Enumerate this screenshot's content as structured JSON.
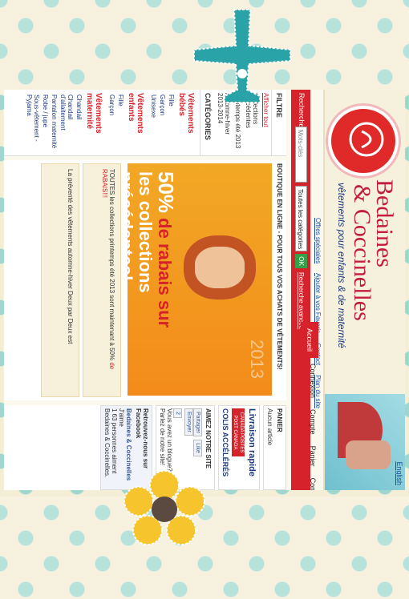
{
  "header": {
    "brand_line1": "Bedaines",
    "brand_line2": "& Coccinelles",
    "tagline": "vêtements pour enfants & de maternité",
    "english_link": "English"
  },
  "toplinks": [
    "Offres spéciales",
    "Ajouter à vos Favoris",
    "Contact",
    "Plan du site"
  ],
  "search": {
    "label": "Recherche :",
    "placeholder": "Mots-clés",
    "category": "Toutes les catégories",
    "ok": "OK",
    "advanced": "Recherche avancée"
  },
  "menu": [
    "Accueil",
    "Connexion",
    "Compte",
    "Panier",
    "Commander"
  ],
  "filter": {
    "title": "FILTRE",
    "show_all": "Afficher tout",
    "items": [
      "Collections précédentes",
      "Printemps été 2013",
      "Automne-hiver 2013-2014"
    ]
  },
  "categories": {
    "title": "CATÉGORIES",
    "groups": [
      {
        "name": "Vêtements bébés",
        "items": [
          "Fille",
          "Garçon",
          "Unisexe"
        ]
      },
      {
        "name": "Vêtements enfants",
        "items": [
          "Fille",
          "Garçon"
        ]
      },
      {
        "name": "Vêtements maternité",
        "items": [
          "Chandail",
          "Chandail d'allaitement",
          "Pantalon maternité",
          "Robe / jupe",
          "Sous-vêtement - Pyjama"
        ]
      }
    ]
  },
  "main": {
    "title": "BOUTIQUE EN LIGNE - POUR TOUS VOS ACHATS DE VÊTEMENTS!",
    "banner_pct": "50%",
    "banner_line1": "de rabais sur",
    "banner_line2": "les collections précédentes!",
    "banner_year": "2013",
    "news1_a": "TOUTES les collections printemps été 2013 sont maintenant à 50%",
    "news1_b": "de RABAIS!!!",
    "news2": "La préventé des vêtements automne-hiver Deux par Deux est"
  },
  "right": {
    "cart_title": "PANIER",
    "cart_empty": "Aucun article",
    "ship_title": "Livraison rapide",
    "post_label": "CANADA POSTES POST CANADA",
    "colis": "COLIS ACCÉLÉRÉS",
    "like_title": "AIMEZ NOTRE SITE",
    "social": [
      "Partager",
      "Like",
      "Envoyer"
    ],
    "gplus_count": "2",
    "blog_q": "Vous avez un blogue?",
    "blog_a": "Parlez de notre site!",
    "fb_title": "Retrouvez-nous sur Facebook",
    "fb_name": "Bedaines & Coccinelles",
    "fb_like": "J'aime",
    "fb_count": "1 63 personnes aiment Bedaines & Coccinelles."
  }
}
